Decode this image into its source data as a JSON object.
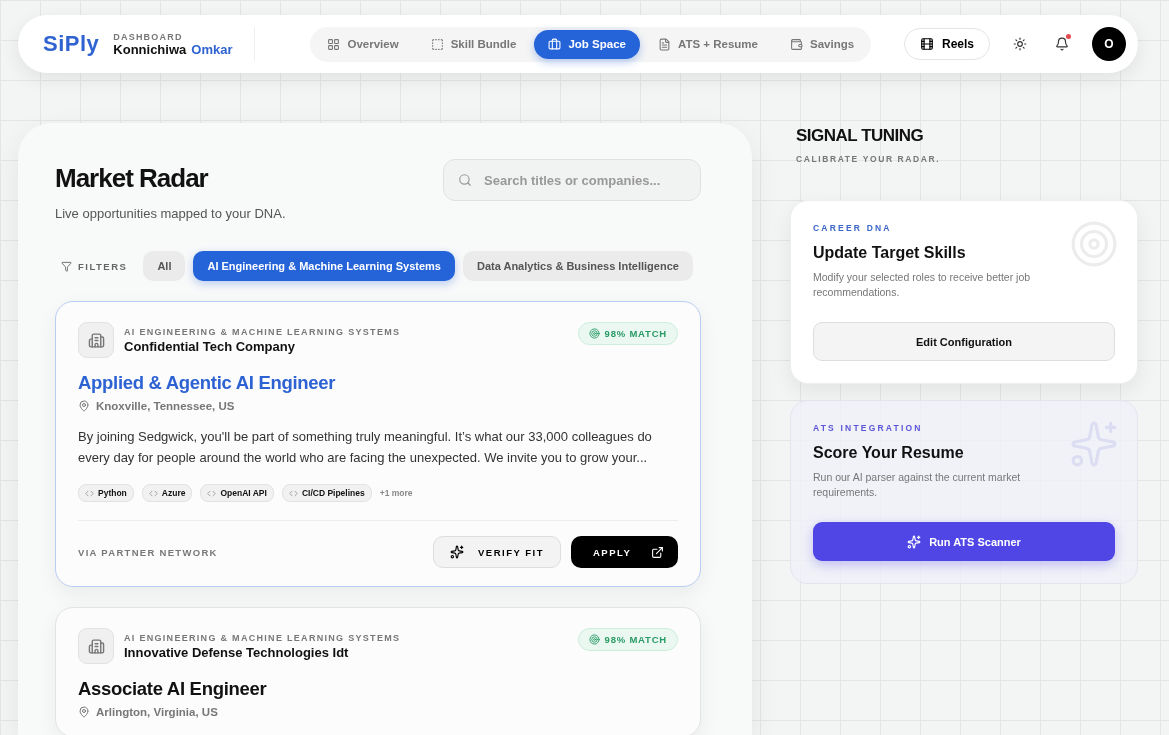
{
  "header": {
    "logo": "SiPly",
    "eyebrow": "DASHBOARD",
    "greeting": "Konnichiwa",
    "user_name": "Omkar",
    "avatar_initial": "O",
    "reels_label": "Reels",
    "has_notification": true
  },
  "nav": [
    {
      "label": "Overview",
      "selected": false
    },
    {
      "label": "Skill Bundle",
      "selected": false
    },
    {
      "label": "Job Space",
      "selected": true
    },
    {
      "label": "ATS + Resume",
      "selected": false
    },
    {
      "label": "Savings",
      "selected": false
    }
  ],
  "market": {
    "title": "Market Radar",
    "subtitle": "Live opportunities mapped to your DNA.",
    "search": {
      "placeholder": "Search titles or companies..."
    },
    "filters_label": "FILTERS",
    "filters": [
      {
        "label": "All",
        "selected": false
      },
      {
        "label": "AI Engineering & Machine Learning Systems",
        "selected": true
      },
      {
        "label": "Data Analytics & Business Intelligence",
        "selected": false
      }
    ],
    "jobs": [
      {
        "category": "AI ENGINEERING & MACHINE LEARNING SYSTEMS",
        "company": "Confidential Tech Company",
        "match": "98% MATCH",
        "title": "Applied & Agentic AI Engineer",
        "highlighted": true,
        "location": "Knoxville, Tennessee, US",
        "description": "By joining Sedgwick, you'll be part of something truly meaningful. It’s what our 33,000 colleagues do every day for people around the world who are facing the unexpected. We invite you to grow your...",
        "tags": [
          "Python",
          "Azure",
          "OpenAI API",
          "CI/CD Pipelines"
        ],
        "more": "+1 more",
        "source": "VIA PARTNER NETWORK",
        "verify_label": "VERIFY FIT",
        "apply_label": "APPLY"
      },
      {
        "category": "AI ENGINEERING & MACHINE LEARNING SYSTEMS",
        "company": "Innovative Defense Technologies Idt",
        "match": "98% MATCH",
        "title": "Associate AI Engineer",
        "highlighted": false,
        "location": "Arlington, Virginia, US"
      }
    ]
  },
  "signal": {
    "title": "SIGNAL TUNING",
    "subtitle": "CALIBRATE YOUR RADAR.",
    "cards": [
      {
        "kind": "plain",
        "eyebrow": "CAREER DNA",
        "title": "Update Target Skills",
        "text": "Modify your selected roles to receive better job recommendations.",
        "button": "Edit Configuration"
      },
      {
        "kind": "accent",
        "eyebrow": "ATS INTEGRATION",
        "title": "Score Your Resume",
        "text": "Run our AI parser against the current market requirements.",
        "button": "Run ATS Scanner"
      }
    ]
  }
}
